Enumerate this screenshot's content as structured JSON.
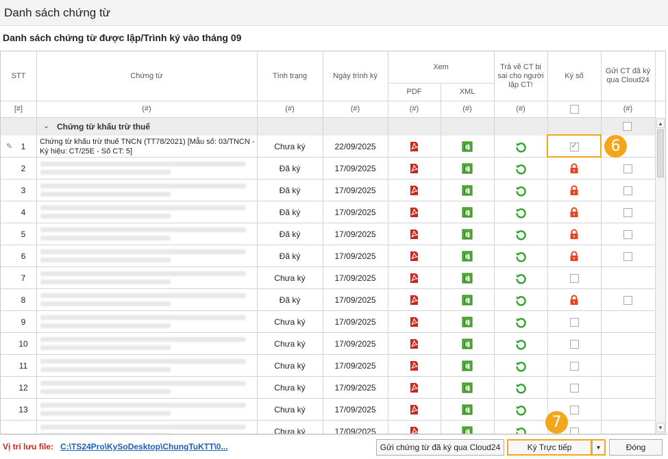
{
  "window": {
    "title": "Danh sách chứng từ"
  },
  "subtitle": "Danh sách chứng từ được lập/Trình ký vào tháng 09",
  "columns": {
    "stt": "STT",
    "document": "Chứng từ",
    "status": "Tình trạng",
    "date": "Ngày trình ký",
    "view": "Xem",
    "pdf": "PDF",
    "xml": "XML",
    "return": "Trả về CT bị sai cho người lập CT!",
    "sign": "Ký số",
    "cloud": "Gửi CT đã ký qua Cloud24"
  },
  "filter": {
    "stt": "[#]",
    "document": "(#)",
    "status": "(#)",
    "date": "(#)",
    "pdf": "(#)",
    "xml": "(#)",
    "return": "(#)",
    "cloud": "(#)"
  },
  "group": {
    "label": "Chứng từ khấu trừ thuế"
  },
  "rows": [
    {
      "stt": "1",
      "doc": "Chứng từ khấu trừ thuế TNCN (TT78/2021) [Mẫu số: 03/TNCN - Ký hiệu: CT/25E - Số CT: 5]",
      "status": "Chưa ký",
      "date": "22/09/2025",
      "sign": "checkbox-checked",
      "cloud": "none"
    },
    {
      "stt": "2",
      "doc": "",
      "status": "Đã ký",
      "date": "17/09/2025",
      "sign": "lock",
      "cloud": "checkbox"
    },
    {
      "stt": "3",
      "doc": "",
      "status": "Đã ký",
      "date": "17/09/2025",
      "sign": "lock",
      "cloud": "checkbox"
    },
    {
      "stt": "4",
      "doc": "",
      "status": "Đã ký",
      "date": "17/09/2025",
      "sign": "lock",
      "cloud": "checkbox"
    },
    {
      "stt": "5",
      "doc": "",
      "status": "Đã ký",
      "date": "17/09/2025",
      "sign": "lock",
      "cloud": "checkbox"
    },
    {
      "stt": "6",
      "doc": "",
      "status": "Đã ký",
      "date": "17/09/2025",
      "sign": "lock",
      "cloud": "checkbox"
    },
    {
      "stt": "7",
      "doc": "",
      "status": "Chưa ký",
      "date": "17/09/2025",
      "sign": "checkbox",
      "cloud": "none"
    },
    {
      "stt": "8",
      "doc": "",
      "status": "Đã ký",
      "date": "17/09/2025",
      "sign": "lock",
      "cloud": "checkbox"
    },
    {
      "stt": "9",
      "doc": "",
      "status": "Chưa ký",
      "date": "17/09/2025",
      "sign": "checkbox",
      "cloud": "none"
    },
    {
      "stt": "10",
      "doc": "",
      "status": "Chưa ký",
      "date": "17/09/2025",
      "sign": "checkbox",
      "cloud": "none"
    },
    {
      "stt": "11",
      "doc": "",
      "status": "Chưa ký",
      "date": "17/09/2025",
      "sign": "checkbox",
      "cloud": "none"
    },
    {
      "stt": "12",
      "doc": "",
      "status": "Chưa ký",
      "date": "17/09/2025",
      "sign": "checkbox",
      "cloud": "none"
    },
    {
      "stt": "13",
      "doc": "",
      "status": "Chưa ký",
      "date": "17/09/2025",
      "sign": "checkbox",
      "cloud": "none"
    },
    {
      "stt": "",
      "doc": "",
      "status": "Chưa ký",
      "date": "17/09/2025",
      "sign": "checkbox",
      "cloud": "none"
    }
  ],
  "callouts": {
    "six": "6",
    "seven": "7"
  },
  "footer": {
    "location_label": "Vị trí lưu file:",
    "location_path": "C:\\TS24Pro\\KySoDesktop\\ChungTuKTT\\0...",
    "send_cloud_button": "Gửi chứng từ đã ký qua Cloud24",
    "sign_direct_button": "Ký Trực tiếp",
    "close_button": "Đóng"
  },
  "colors": {
    "accent": "#f3a61c",
    "pdf": "#d0241c",
    "xml": "#3fae29",
    "return": "#2da52a",
    "lock": "#e8431c",
    "link": "#1a5fb4"
  }
}
